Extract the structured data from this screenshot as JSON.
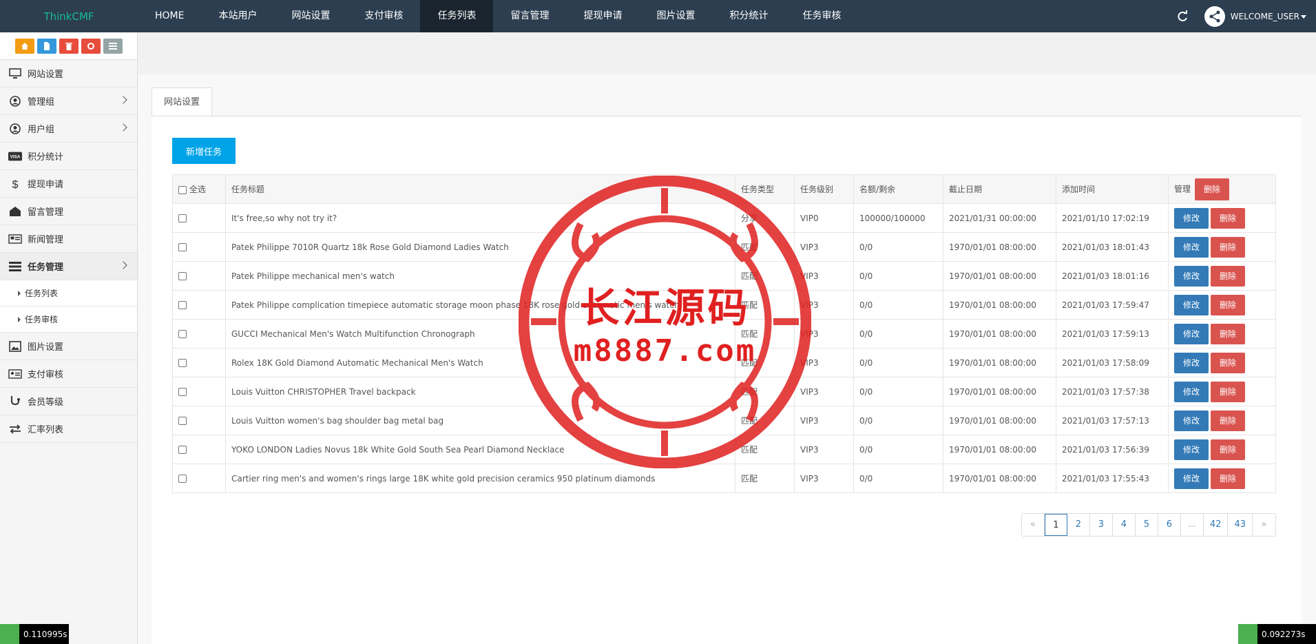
{
  "brand": "ThinkCMF",
  "nav": [
    "HOME",
    "本站用户",
    "网站设置",
    "支付审核",
    "任务列表",
    "留言管理",
    "提现申请",
    "图片设置",
    "积分统计",
    "任务审核"
  ],
  "welcome": "WELCOME_USER",
  "sidebar": {
    "items": [
      {
        "label": "网站设置",
        "icon": "monitor-icon"
      },
      {
        "label": "管理组",
        "icon": "user-circle-icon"
      },
      {
        "label": "用户组",
        "icon": "user-circle-icon"
      },
      {
        "label": "积分统计",
        "icon": "visa-icon"
      },
      {
        "label": "提现申请",
        "icon": "dollar-icon"
      },
      {
        "label": "留言管理",
        "icon": "envelope-icon"
      },
      {
        "label": "新闻管理",
        "icon": "newspaper-icon"
      },
      {
        "label": "任务管理",
        "icon": "tasks-icon"
      },
      {
        "label": "图片设置",
        "icon": "image-icon"
      },
      {
        "label": "支付审核",
        "icon": "id-card-icon"
      },
      {
        "label": "会员等级",
        "icon": "stethoscope-icon"
      },
      {
        "label": "汇率列表",
        "icon": "exchange-icon"
      }
    ],
    "sub_items": [
      "任务列表",
      "任务审核"
    ]
  },
  "tab_label": "网站设置",
  "add_button": "新增任务",
  "table": {
    "headers": {
      "select_all": "全选",
      "title": "任务标题",
      "type": "任务类型",
      "level": "任务级别",
      "quota": "名额/剩余",
      "deadline": "截止日期",
      "added": "添加时间",
      "manage": "管理",
      "delete": "删除"
    },
    "edit_label": "修改",
    "delete_label": "删除",
    "rows": [
      {
        "title": "It's free,so why not try it?",
        "type": "分享",
        "level": "VIP0",
        "quota": "100000/100000",
        "deadline": "2021/01/31 00:00:00",
        "added": "2021/01/10 17:02:19"
      },
      {
        "title": "Patek Philippe 7010R Quartz 18k Rose Gold Diamond Ladies Watch",
        "type": "匹配",
        "level": "VIP3",
        "quota": "0/0",
        "deadline": "1970/01/01 08:00:00",
        "added": "2021/01/03 18:01:43"
      },
      {
        "title": "Patek Philippe mechanical men's watch",
        "type": "匹配",
        "level": "VIP3",
        "quota": "0/0",
        "deadline": "1970/01/01 08:00:00",
        "added": "2021/01/03 18:01:16"
      },
      {
        "title": "Patek Philippe complication timepiece automatic storage moon phase 18K rose gold automatic men's watch",
        "type": "匹配",
        "level": "VIP3",
        "quota": "0/0",
        "deadline": "1970/01/01 08:00:00",
        "added": "2021/01/03 17:59:47"
      },
      {
        "title": "GUCCI Mechanical Men's Watch Multifunction Chronograph",
        "type": "匹配",
        "level": "VIP3",
        "quota": "0/0",
        "deadline": "1970/01/01 08:00:00",
        "added": "2021/01/03 17:59:13"
      },
      {
        "title": "Rolex 18K Gold Diamond Automatic Mechanical Men's Watch",
        "type": "匹配",
        "level": "VIP3",
        "quota": "0/0",
        "deadline": "1970/01/01 08:00:00",
        "added": "2021/01/03 17:58:09"
      },
      {
        "title": "Louis Vuitton CHRISTOPHER Travel backpack",
        "type": "匹配",
        "level": "VIP3",
        "quota": "0/0",
        "deadline": "1970/01/01 08:00:00",
        "added": "2021/01/03 17:57:38"
      },
      {
        "title": "Louis Vuitton women's bag shoulder bag metal bag",
        "type": "匹配",
        "level": "VIP3",
        "quota": "0/0",
        "deadline": "1970/01/01 08:00:00",
        "added": "2021/01/03 17:57:13"
      },
      {
        "title": "YOKO LONDON Ladies Novus 18k White Gold South Sea Pearl Diamond Necklace",
        "type": "匹配",
        "level": "VIP3",
        "quota": "0/0",
        "deadline": "1970/01/01 08:00:00",
        "added": "2021/01/03 17:56:39"
      },
      {
        "title": "Cartier ring men's and women's rings large 18K white gold precision ceramics 950 platinum diamonds",
        "type": "匹配",
        "level": "VIP3",
        "quota": "0/0",
        "deadline": "1970/01/01 08:00:00",
        "added": "2021/01/03 17:55:43"
      }
    ]
  },
  "pagination": [
    "«",
    "1",
    "2",
    "3",
    "4",
    "5",
    "6",
    "...",
    "42",
    "43",
    "»"
  ],
  "pagination_active": "1",
  "watermark": {
    "cn": "长江源码",
    "en": "m8887.com"
  },
  "timers": {
    "left": "0.110995s",
    "right": "0.092273s"
  },
  "colors": {
    "navbar": "#2c3e50",
    "brand": "#18bc9c",
    "primary": "#337ab7",
    "danger": "#d9534f",
    "add": "#00a3e8",
    "watermark": "#e02020"
  }
}
